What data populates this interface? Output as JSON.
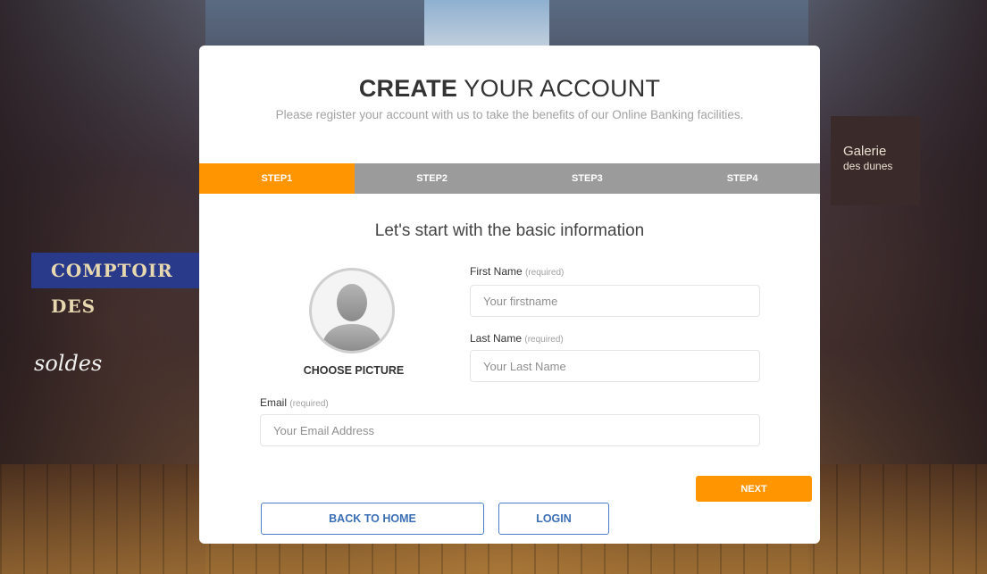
{
  "form": {
    "title_bold": "CREATE",
    "title_rest": " YOUR ACCOUNT",
    "subtitle": "Please register your account with us to take the benefits of our Online Banking facilities.",
    "steps": [
      {
        "label": "STEP1",
        "active": true
      },
      {
        "label": "STEP2",
        "active": false
      },
      {
        "label": "STEP3",
        "active": false
      },
      {
        "label": "STEP4",
        "active": false
      }
    ],
    "section_heading": "Let's start with the basic information",
    "choose_picture": "CHOOSE PICTURE",
    "first_name": {
      "label": "First Name",
      "required": "(required)",
      "placeholder": "Your firstname",
      "value": ""
    },
    "last_name": {
      "label": "Last Name",
      "required": "(required)",
      "placeholder": "Your Last Name",
      "value": ""
    },
    "email": {
      "label": "Email",
      "required": "(required)",
      "placeholder": "Your Email Address",
      "value": ""
    },
    "next_label": "NEXT",
    "back_home_label": "BACK TO HOME",
    "login_label": "LOGIN"
  },
  "background": {
    "shop_sign": "COMPTOIR DES",
    "galerie_line1": "Galerie",
    "galerie_line2": "des dunes",
    "soldes": "soldes"
  },
  "colors": {
    "accent": "#ff9500",
    "step_bar": "#9b9b9b",
    "link_blue": "#3a6fb5"
  }
}
